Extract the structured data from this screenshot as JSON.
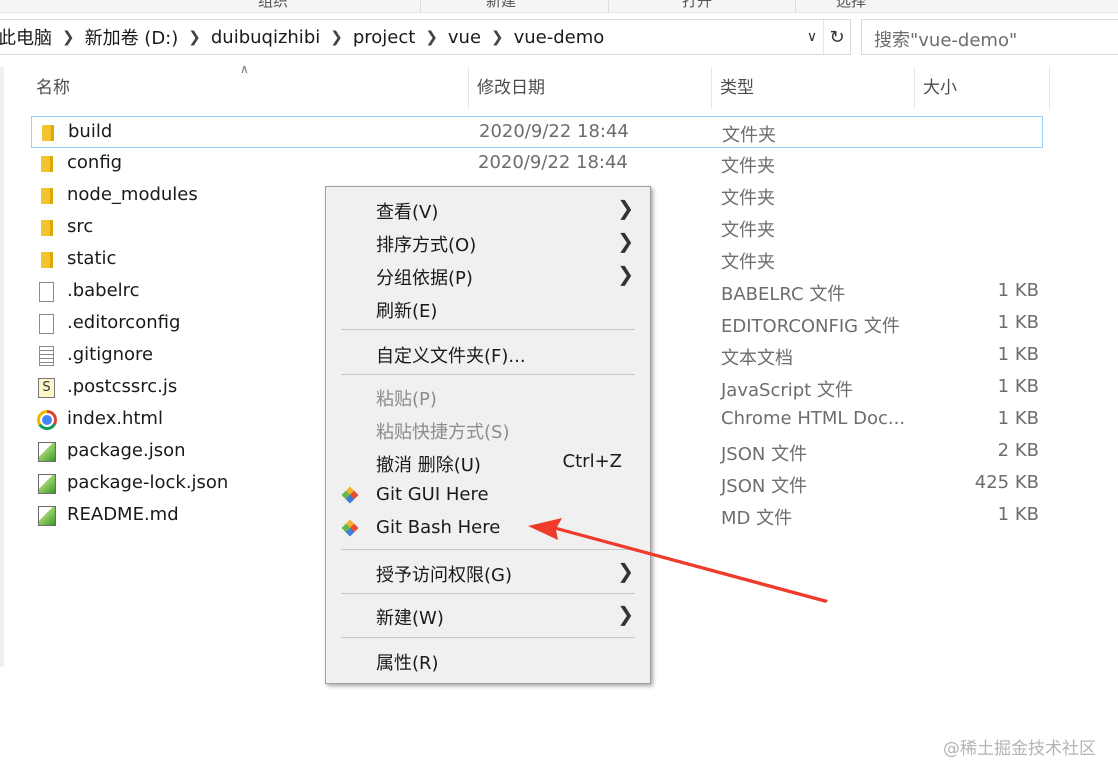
{
  "ribbon": {
    "tabs": [
      "组织",
      "新建",
      "打开",
      "选择"
    ]
  },
  "address": {
    "crumbs": [
      "此电脑",
      "新加卷 (D:)",
      "duibuqizhibi",
      "project",
      "vue",
      "vue-demo"
    ],
    "search_placeholder": "搜索\"vue-demo\""
  },
  "columns": {
    "name": "名称",
    "date": "修改日期",
    "type": "类型",
    "size": "大小"
  },
  "files": [
    {
      "name": "build",
      "date": "2020/9/22 18:44",
      "type": "文件夹",
      "size": "",
      "icon": "folder-icon"
    },
    {
      "name": "config",
      "date": "2020/9/22 18:44",
      "type": "文件夹",
      "size": "",
      "icon": "folder-icon"
    },
    {
      "name": "node_modules",
      "date": "",
      "type": "文件夹",
      "size": "",
      "icon": "folder-icon"
    },
    {
      "name": "src",
      "date": "",
      "type": "文件夹",
      "size": "",
      "icon": "folder-icon"
    },
    {
      "name": "static",
      "date": "",
      "type": "文件夹",
      "size": "",
      "icon": "folder-icon"
    },
    {
      "name": ".babelrc",
      "date": "",
      "type": "BABELRC 文件",
      "size": "1 KB",
      "icon": "file-icon"
    },
    {
      "name": ".editorconfig",
      "date": "",
      "type": "EDITORCONFIG 文件",
      "size": "1 KB",
      "icon": "file-icon"
    },
    {
      "name": ".gitignore",
      "date": "",
      "type": "文本文档",
      "size": "1 KB",
      "icon": "text-file-icon"
    },
    {
      "name": ".postcssrc.js",
      "date": "",
      "type": "JavaScript 文件",
      "size": "1 KB",
      "icon": "js-file-icon"
    },
    {
      "name": "index.html",
      "date": "",
      "type": "Chrome HTML Doc...",
      "size": "1 KB",
      "icon": "chrome-icon"
    },
    {
      "name": "package.json",
      "date": "",
      "type": "JSON 文件",
      "size": "2 KB",
      "icon": "json-file-icon"
    },
    {
      "name": "package-lock.json",
      "date": "",
      "type": "JSON 文件",
      "size": "425 KB",
      "icon": "json-file-icon"
    },
    {
      "name": "README.md",
      "date": "",
      "type": "MD 文件",
      "size": "1 KB",
      "icon": "json-file-icon"
    }
  ],
  "context_menu": {
    "view": "查看(V)",
    "sort": "排序方式(O)",
    "group": "分组依据(P)",
    "refresh": "刷新(E)",
    "customize": "自定义文件夹(F)...",
    "paste": "粘贴(P)",
    "paste_shortcut": "粘贴快捷方式(S)",
    "undo_delete": "撤消 删除(U)",
    "undo_shortcut": "Ctrl+Z",
    "git_gui": "Git GUI Here",
    "git_bash": "Git Bash Here",
    "grant_access": "授予访问权限(G)",
    "new": "新建(W)",
    "properties": "属性(R)"
  },
  "annotation_color": "#ee3b2b",
  "watermark": "@稀土掘金技术社区"
}
